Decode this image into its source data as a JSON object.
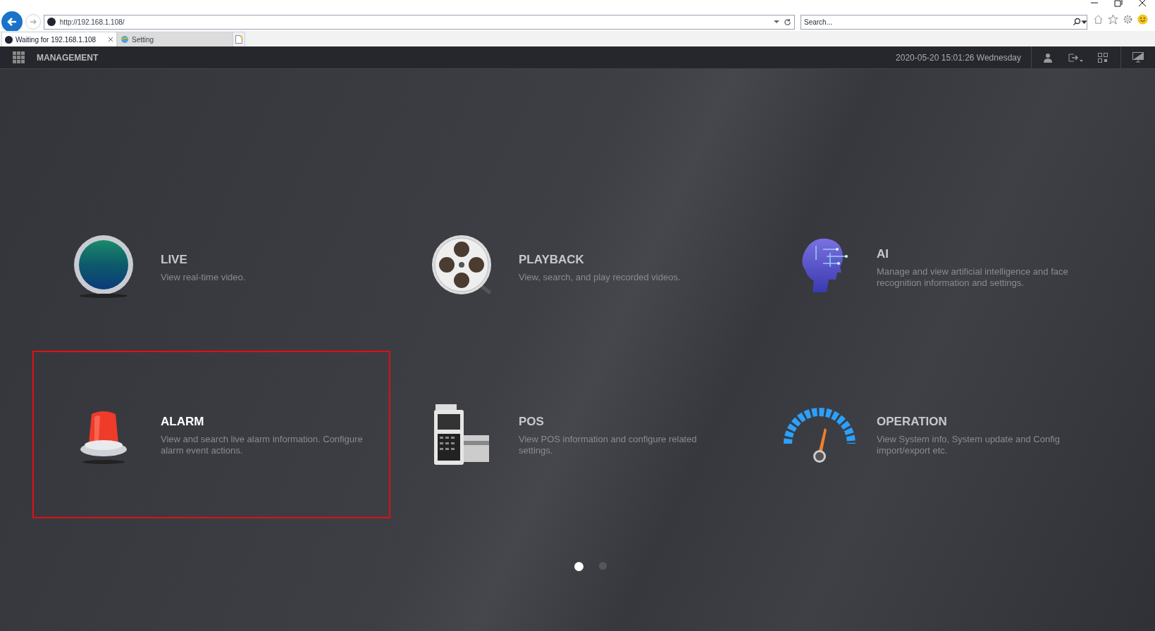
{
  "browser": {
    "address": "http://192.168.1.108/",
    "search": {
      "placeholder": "Search..."
    },
    "tabs": [
      {
        "label": "Waiting for 192.168.1.108",
        "selected": true
      },
      {
        "label": "Setting",
        "selected": false
      }
    ]
  },
  "header": {
    "title": "MANAGEMENT",
    "datetime": "2020-05-20 15:01:26 Wednesday"
  },
  "tiles": [
    {
      "kind": "live",
      "title": "LIVE",
      "description": "View real-time video.",
      "selected": false
    },
    {
      "kind": "playback",
      "title": "PLAYBACK",
      "description": "View, search, and play recorded videos.",
      "selected": false
    },
    {
      "kind": "ai",
      "title": "AI",
      "description": "Manage and view artificial intelligence and face recognition information and settings.",
      "selected": false
    },
    {
      "kind": "alarm",
      "title": "ALARM",
      "description": "View and search live alarm information. Configure alarm event actions.",
      "selected": true
    },
    {
      "kind": "pos",
      "title": "POS",
      "description": "View POS information and configure related settings.",
      "selected": false
    },
    {
      "kind": "operation",
      "title": "OPERATION",
      "description": "View System info, System update and Config import/export etc.",
      "selected": false
    }
  ],
  "pages": [
    {
      "selected": true
    },
    {
      "selected": false
    }
  ]
}
